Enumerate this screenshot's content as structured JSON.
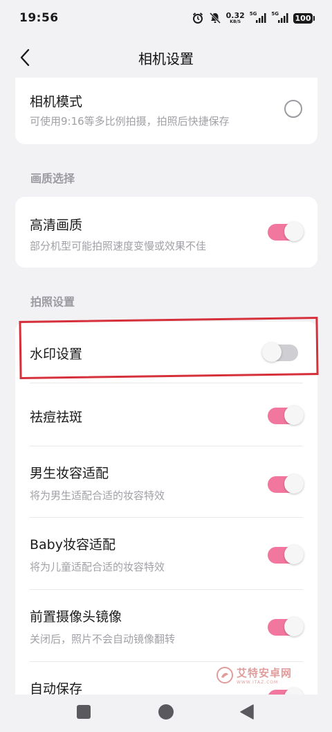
{
  "status_bar": {
    "time": "19:56",
    "net_speed_value": "0.32",
    "net_speed_unit": "KB/S",
    "sim1_label": "5G",
    "sim2_label": "5G",
    "battery": "100"
  },
  "header": {
    "title": "相机设置",
    "back_icon": "chevron-left-icon"
  },
  "camera_mode": {
    "title": "相机模式",
    "subtitle": "可使用9:16等多比例拍摄，拍照后快捷保存",
    "selected": false
  },
  "quality_section": {
    "label": "画质选择",
    "hd": {
      "title": "高清画质",
      "subtitle": "部分机型可能拍照速度变慢或效果不佳",
      "on": true
    }
  },
  "photo_section": {
    "label": "拍照设置",
    "items": [
      {
        "title": "水印设置",
        "subtitle": "",
        "on": false
      },
      {
        "title": "祛痘祛斑",
        "subtitle": "",
        "on": true
      },
      {
        "title": "男生妆容适配",
        "subtitle": "将为男生适配合适的妆容特效",
        "on": true
      },
      {
        "title": "Baby妆容适配",
        "subtitle": "将为儿童适配合适的妆容特效",
        "on": true
      },
      {
        "title": "前置摄像头镜像",
        "subtitle": "关闭后，照片不会自动镜像翻转",
        "on": true
      },
      {
        "title": "自动保存",
        "subtitle": "",
        "on": true
      }
    ]
  },
  "watermark": {
    "text": "艾特安卓网",
    "sub": "WWW.ITAZ.COM"
  },
  "colors": {
    "accent": "#f2779f",
    "toggle_off": "#cfcfd3",
    "highlight": "#d6303a",
    "background": "#f2f2f4"
  }
}
